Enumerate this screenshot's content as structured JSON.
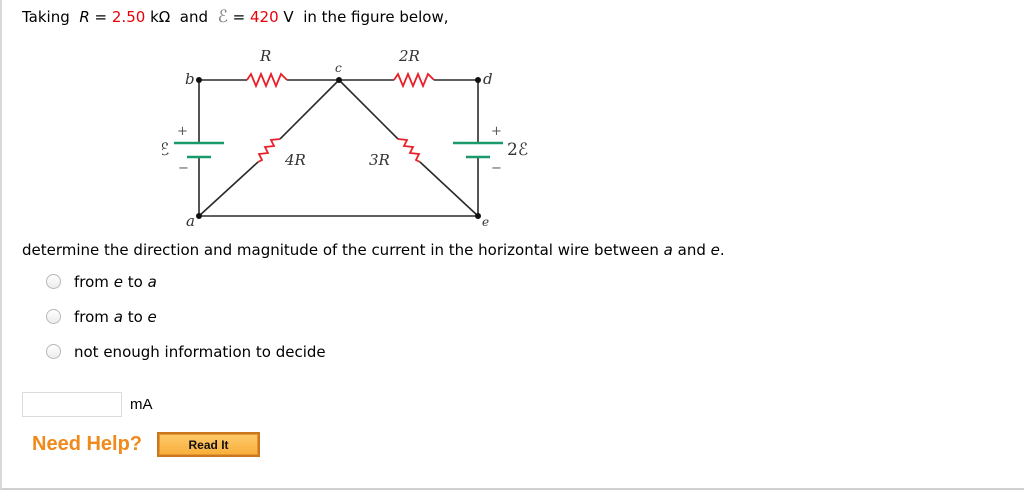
{
  "prompt": {
    "prefix": "Taking",
    "r_symbol": "R",
    "eq1": "=",
    "r_value": "2.50",
    "r_unit": "kΩ",
    "and": "and",
    "emf_symbol": "ℰ",
    "eq2": "=",
    "emf_value": "420",
    "emf_unit": "V",
    "suffix": "in the figure below,"
  },
  "figure": {
    "labels": {
      "node_a": "a",
      "node_b": "b",
      "node_c": "c",
      "node_d": "d",
      "node_e": "e",
      "r_top_left": "R",
      "r_top_right": "2R",
      "r_diag_left": "4R",
      "r_diag_right": "3R",
      "emf_left": "ℰ",
      "emf_right": "2ℰ",
      "plus": "+",
      "minus": "−"
    },
    "colors": {
      "resistor": "#e8202a",
      "battery": "#1a9a6a",
      "wire": "#2a2a2a"
    }
  },
  "question": {
    "text_before": "determine the direction and magnitude of the current in the horizontal wire between",
    "var_a": "a",
    "and": "and",
    "var_e": "e",
    "end": "."
  },
  "options": [
    {
      "p1": "from",
      "v1": "e",
      "p2": "to",
      "v2": "a"
    },
    {
      "p1": "from",
      "v1": "a",
      "p2": "to",
      "v2": "e"
    },
    {
      "label": "not enough information to decide"
    }
  ],
  "answer": {
    "value": "",
    "unit": "mA"
  },
  "help": {
    "label": "Need Help?",
    "button": "Read It"
  },
  "colors": {
    "highlight": "#e8000b",
    "help": "#f08a1c"
  }
}
